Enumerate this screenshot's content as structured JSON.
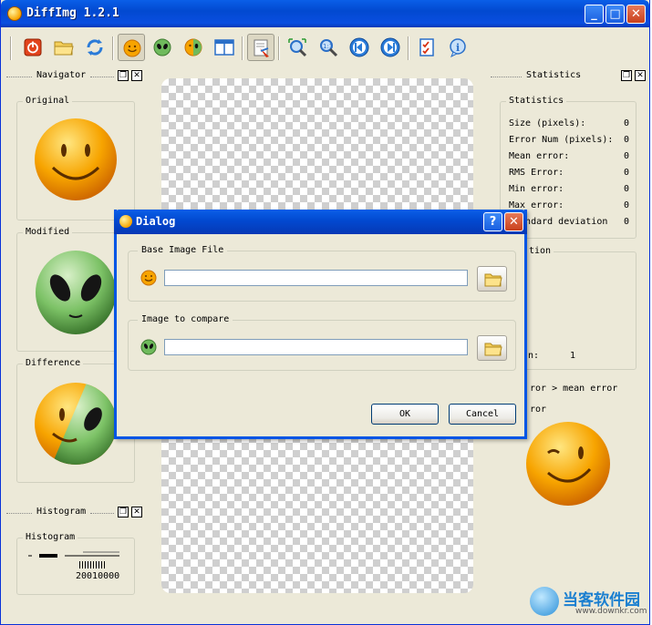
{
  "app": {
    "title": "DiffImg 1.2.1"
  },
  "window_buttons": {
    "minimize": "_",
    "maximize": "□",
    "close": "✕"
  },
  "toolbar": {
    "tools": [
      {
        "icon": "power-icon",
        "pressed": false
      },
      {
        "icon": "open-folder-icon",
        "pressed": false
      },
      {
        "icon": "refresh-icon",
        "pressed": false
      },
      {
        "icon": "smiley-original-icon",
        "pressed": true
      },
      {
        "icon": "alien-modified-icon",
        "pressed": false
      },
      {
        "icon": "difference-icon",
        "pressed": false
      },
      {
        "icon": "dual-panel-icon",
        "pressed": false
      },
      {
        "icon": "show-error-icon",
        "pressed": true
      },
      {
        "icon": "fit-window-icon",
        "pressed": false
      },
      {
        "icon": "zoom-original-icon",
        "pressed": false
      },
      {
        "icon": "previous-icon",
        "pressed": false
      },
      {
        "icon": "next-icon",
        "pressed": false
      },
      {
        "icon": "preferences-icon",
        "pressed": false
      },
      {
        "icon": "about-icon",
        "pressed": false
      }
    ]
  },
  "navigator": {
    "title": "Navigator",
    "original": "Original",
    "modified": "Modified",
    "difference": "Difference"
  },
  "histogram": {
    "title": "Histogram",
    "group": "Histogram",
    "axis_text": "20010000"
  },
  "statistics": {
    "dock_title": "Statistics",
    "group_title": "Statistics",
    "rows": [
      {
        "label": "Size (pixels):",
        "value": "0"
      },
      {
        "label": "Error Num (pixels):",
        "value": "0"
      },
      {
        "label": "Mean error:",
        "value": "0"
      },
      {
        "label": "RMS Error:",
        "value": "0"
      },
      {
        "label": "Min error:",
        "value": "0"
      },
      {
        "label": "Max error:",
        "value": "0"
      },
      {
        "label": "Standard deviation",
        "value": "0"
      }
    ],
    "behind_dialog": {
      "group_fragment": "tion",
      "value_label": "n:",
      "value": "1",
      "error_line_1": "ror > mean error",
      "error_line_2": "ror"
    }
  },
  "dialog": {
    "title": "Dialog",
    "help": "?",
    "close": "✕",
    "base_label": "Base Image File",
    "base_value": "",
    "compare_label": "Image to compare",
    "compare_value": "",
    "ok": "OK",
    "cancel": "Cancel"
  },
  "watermark": {
    "text": "当客软件园",
    "url": "www.downkr.com"
  },
  "colors": {
    "titlebar": "#0a4ee0",
    "window_bg": "#ece9d8",
    "smiley": "#f7a400",
    "alien": "#6fba5c"
  }
}
